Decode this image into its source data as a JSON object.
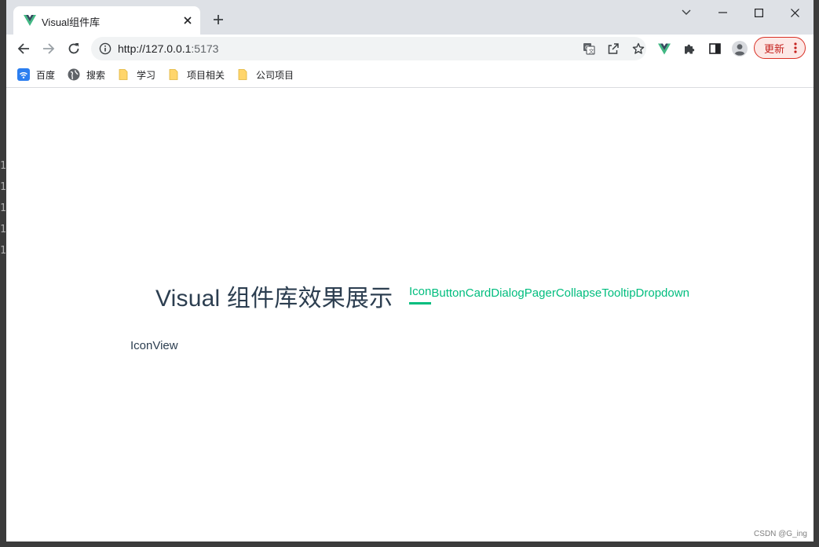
{
  "gutter": {
    "line_numbers": [
      "1",
      "1",
      "1",
      "1",
      "1"
    ]
  },
  "browser": {
    "tab": {
      "title": "Visual组件库",
      "favicon": "vue-logo-icon",
      "close_icon": "close-icon"
    },
    "new_tab_icon": "plus-icon",
    "window_controls": [
      "chevron-down-icon",
      "minimize-icon",
      "maximize-icon",
      "close-icon"
    ],
    "url": {
      "host": "http://127.0.0.1",
      "port": ":5173"
    },
    "omnibox_icons": [
      "translate-icon",
      "share-icon",
      "star-icon"
    ],
    "extensions": [
      "vue-devtools-icon",
      "puzzle-icon",
      "sidepanel-icon",
      "profile-icon"
    ],
    "update_button": {
      "label": "更新"
    },
    "bookmarks": [
      {
        "label": "百度",
        "icon": "wifi-icon"
      },
      {
        "label": "搜索",
        "icon": "globe-icon"
      },
      {
        "label": "学习",
        "icon": "folder-icon"
      },
      {
        "label": "项目相关",
        "icon": "folder-icon"
      },
      {
        "label": "公司项目",
        "icon": "folder-icon"
      }
    ]
  },
  "page": {
    "title": "Visual 组件库效果展示",
    "nav": [
      "Icon",
      "Button",
      "Card",
      "Dialog",
      "Pager",
      "Collapse",
      "Tooltip",
      "Dropdown"
    ],
    "active_nav": "Icon",
    "view_text": "IconView",
    "watermark": "CSDN @G_ing"
  },
  "colors": {
    "accent": "#00bd7e",
    "heading": "#2c3e50",
    "titlebar": "#dee1e6",
    "update_red": "#d93025"
  }
}
